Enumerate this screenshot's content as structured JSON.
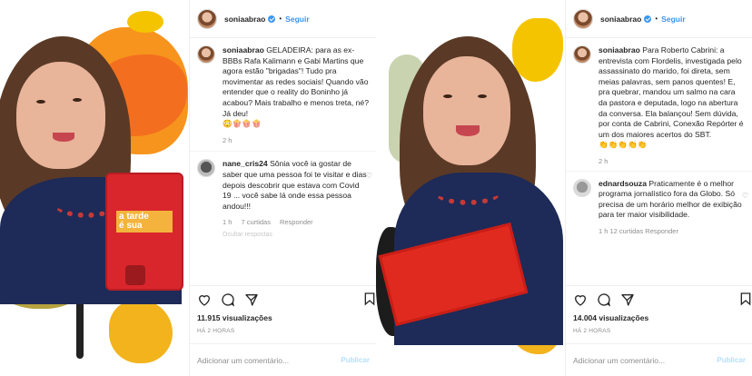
{
  "left_post": {
    "username": "soniaabrao",
    "follow_label": "Seguir",
    "caption_user": "soniaabrao",
    "caption_text": "GELADEIRA: para as ex-BBBs Rafa Kalimann e Gabi Martins que agora estão \"brigadas\"! Tudo pra movimentar as redes sociais! Quando vão entender que o reality do Boninho já acabou? Mais trabalho e menos treta, né? Já deu!",
    "caption_emojis": "😳🍿🍿🍿",
    "caption_time": "2 h",
    "comment": {
      "user": "nane_cris24",
      "text": "Sônia você ia gostar de saber que uma pessoa foi te visitar e dias depois descobrir que estava com Covid 19 ... você sabe lá onde essa pessoa andou!!!",
      "time": "1 h",
      "likes": "7 curtidas",
      "reply": "Responder",
      "hidden": "Ocultar respostas"
    },
    "views": "11.915 visualizações",
    "posted": "HÁ 2 HORAS",
    "add_comment_placeholder": "Adicionar um comentário...",
    "publish_label": "Publicar",
    "image_logo_text_1": "a tarde",
    "image_logo_text_2": "é sua"
  },
  "right_post": {
    "username": "soniaabrao",
    "follow_label": "Seguir",
    "caption_user": "soniaabrao",
    "caption_text": "Para Roberto Cabrini: a entrevista com Flordelis, investigada pelo assassinato do marido, foi direta, sem meias palavras, sem panos quentes! E, pra quebrar, mandou um salmo na cara da pastora e deputada, logo na abertura da conversa. Ela balançou! Sem dúvida, por conta de Cabrini, Conexão Repórter é um dos maiores acertos do SBT.",
    "caption_emojis": "👏👏👏👏👏",
    "caption_time": "2 h",
    "comment": {
      "user": "ednardsouza",
      "text": "Praticamente é o melhor programa jornalístico fora da Globo. Só precisa de um horário melhor de exibição para ter maior visibilidade.",
      "meta": "1 h   12 curtidas   Responder"
    },
    "views": "14.004 visualizações",
    "posted": "HÁ 2 HORAS",
    "add_comment_placeholder": "Adicionar um comentário...",
    "publish_label": "Publicar"
  },
  "colors": {
    "accent_blue": "#3897f0",
    "splash_orange": "#f7941d",
    "splash_yellow": "#f5c400",
    "fridge_red": "#d9262c"
  }
}
